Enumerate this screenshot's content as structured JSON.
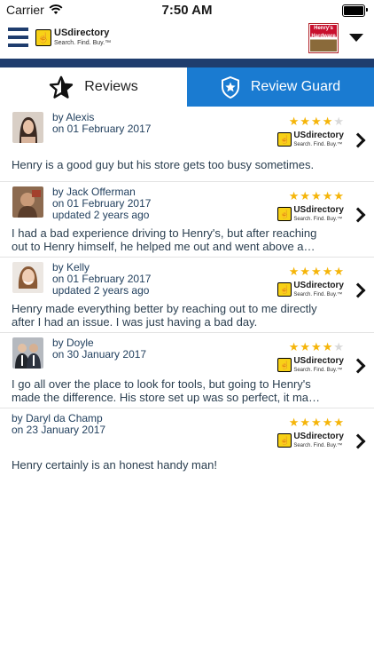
{
  "status_bar": {
    "carrier": "Carrier",
    "time": "7:50 AM",
    "battery_level": 1.0
  },
  "header": {
    "logo": {
      "name": "USdirectory",
      "tagline": "Search. Find. Buy.™"
    },
    "store_thumb_text": "Henry's Hardware"
  },
  "tabs": [
    {
      "label": "Reviews",
      "active": true
    },
    {
      "label": "Review Guard",
      "active": false
    }
  ],
  "reviews": [
    {
      "author": "by Alexis",
      "date": "on 01 February 2017",
      "updated": "",
      "text": "Henry is a good guy but his store gets too busy sometimes.",
      "rating": 4
    },
    {
      "author": "by Jack Offerman",
      "date": "on 01 February 2017",
      "updated": "updated 2 years ago",
      "text": "I had a bad experience driving to Henry's,  but after reaching out to Henry himself, he helped me out and went above a…",
      "rating": 5
    },
    {
      "author": "by Kelly",
      "date": "on 01 February 2017",
      "updated": "updated 2 years ago",
      "text": "Henry made everything better by reaching out to me directly after I had an issue. I was just having a bad day.",
      "rating": 5
    },
    {
      "author": "by Doyle",
      "date": "on 30 January 2017",
      "updated": "",
      "text": "I go all over the place to look for tools, but going to Henry's made the difference. His store set up was so perfect, it ma…",
      "rating": 4
    },
    {
      "author": "by Daryl da Champ",
      "date": "on 23 January 2017",
      "updated": "",
      "text": "Henry certainly is an honest handy man!",
      "rating": 5
    }
  ],
  "colors": {
    "navy": "#1f3d6e",
    "tab_blue": "#1a7bd1",
    "star": "#f5b50a"
  }
}
